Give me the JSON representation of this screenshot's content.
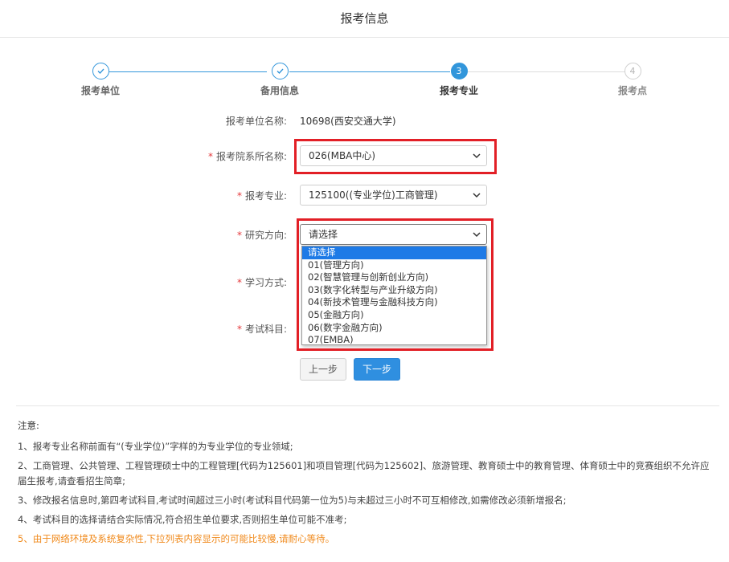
{
  "page": {
    "title": "报考信息"
  },
  "steps": [
    {
      "label": "报考单位",
      "state": "done"
    },
    {
      "label": "备用信息",
      "state": "done"
    },
    {
      "label": "报考专业",
      "number": "3",
      "state": "active"
    },
    {
      "label": "报考点",
      "number": "4",
      "state": "todo"
    }
  ],
  "form": {
    "unit": {
      "label": "报考单位名称:",
      "value": "10698(西安交通大学)"
    },
    "department": {
      "label": "报考院系所名称:",
      "value": "026(MBA中心)"
    },
    "major": {
      "label": "报考专业:",
      "value": "125100((专业学位)工商管理)"
    },
    "direction": {
      "label": "研究方向:",
      "value": "请选择",
      "options": [
        "请选择",
        "01(管理方向)",
        "02(智慧管理与创新创业方向)",
        "03(数字化转型与产业升级方向)",
        "04(新技术管理与金融科技方向)",
        "05(金融方向)",
        "06(数字金融方向)",
        "07(EMBA)"
      ]
    },
    "study_mode": {
      "label": "学习方式:"
    },
    "exam_subjects": {
      "label": "考试科目:"
    },
    "required_mark": "*"
  },
  "buttons": {
    "prev": "上一步",
    "next": "下一步"
  },
  "notes": {
    "title": "注意:",
    "items": [
      "1、报考专业名称前面有“(专业学位)”字样的为专业学位的专业领域;",
      "2、工商管理、公共管理、工程管理硕士中的工程管理[代码为125601]和项目管理[代码为125602]、旅游管理、教育硕士中的教育管理、体育硕士中的竞赛组织不允许应届生报考,请查看招生简章;",
      "3、修改报名信息时,第四考试科目,考试时间超过三小时(考试科目代码第一位为5)与未超过三小时不可互相修改,如需修改必须新增报名;",
      "4、考试科目的选择请结合实际情况,符合招生单位要求,否则招生单位可能不准考;",
      "5、由于网络环境及系统复杂性,下拉列表内容显示的可能比较慢,请耐心等待。"
    ]
  },
  "colors": {
    "primary": "#3296db",
    "highlight": "#e21f26",
    "warning": "#f08a1c",
    "selected_option": "#1e7ae6"
  }
}
